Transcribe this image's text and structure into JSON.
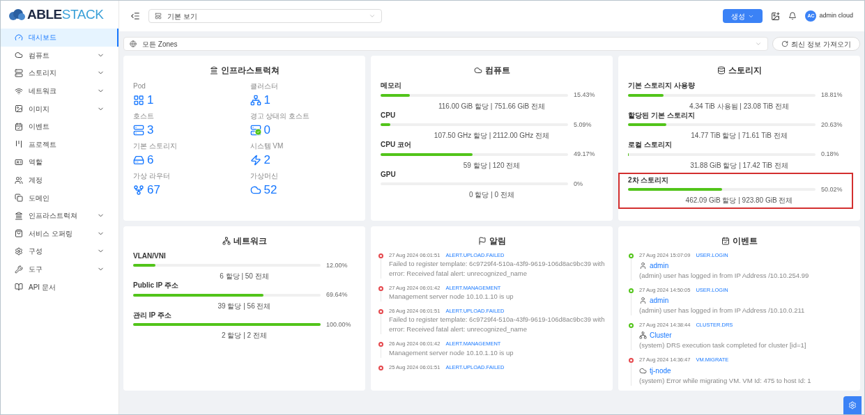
{
  "brand": {
    "part1": "ABLE",
    "part2": "STACK"
  },
  "sidebar": {
    "items": [
      {
        "label": "대시보드",
        "kind": "link",
        "selected": true
      },
      {
        "label": "컴퓨트",
        "kind": "group",
        "selected": false
      },
      {
        "label": "스토리지",
        "kind": "group",
        "selected": false
      },
      {
        "label": "네트워크",
        "kind": "group",
        "selected": false
      },
      {
        "label": "이미지",
        "kind": "group",
        "selected": false
      },
      {
        "label": "이벤트",
        "kind": "link",
        "selected": false
      },
      {
        "label": "프로젝트",
        "kind": "link",
        "selected": false
      },
      {
        "label": "역할",
        "kind": "link",
        "selected": false
      },
      {
        "label": "계정",
        "kind": "link",
        "selected": false
      },
      {
        "label": "도메인",
        "kind": "link",
        "selected": false
      },
      {
        "label": "인프라스트럭쳐",
        "kind": "group",
        "selected": false
      },
      {
        "label": "서비스 오퍼링",
        "kind": "group",
        "selected": false
      },
      {
        "label": "구성",
        "kind": "group",
        "selected": false
      },
      {
        "label": "도구",
        "kind": "group",
        "selected": false
      },
      {
        "label": "API 문서",
        "kind": "link",
        "selected": false
      }
    ]
  },
  "header": {
    "view_select": "기본 보기",
    "create_button": "생성",
    "user": {
      "initials": "AC",
      "name": "admin cloud"
    }
  },
  "zone_select": "모든 Zones",
  "refresh_button": "최신 정보 가져오기",
  "infrastructure": {
    "title": "인프라스트럭쳐",
    "stats": [
      {
        "label": "Pod",
        "value": "1"
      },
      {
        "label": "클러스터",
        "value": "1"
      },
      {
        "label": "호스트",
        "value": "3"
      },
      {
        "label": "경고 상태의 호스트",
        "value": "0"
      },
      {
        "label": "기본 스토리지",
        "value": "6"
      },
      {
        "label": "시스템 VM",
        "value": "2"
      },
      {
        "label": "가상 라우터",
        "value": "67"
      },
      {
        "label": "가상머신",
        "value": "52"
      }
    ]
  },
  "compute": {
    "title": "컴퓨트",
    "rows": [
      {
        "label": "메모리",
        "level": 0.1543,
        "percent": "15.43%",
        "detail": "116.00 GiB 할당 | 751.66 GiB 전체"
      },
      {
        "label": "CPU",
        "level": 0.0509,
        "percent": "5.09%",
        "detail": "107.50 GHz 할당 | 2112.00 GHz 전체"
      },
      {
        "label": "CPU 코어",
        "level": 0.4917,
        "percent": "49.17%",
        "detail": "59 할당 | 120 전체"
      },
      {
        "label": "GPU",
        "level": 0,
        "percent": "0%",
        "detail": "0 할당 | 0 전체"
      }
    ]
  },
  "storage": {
    "title": "스토리지",
    "rows": [
      {
        "label": "기본 스토리지 사용량",
        "level": 0.1881,
        "percent": "18.81%",
        "detail": "4.34 TiB 사용됨 | 23.08 TiB 전체",
        "highlighted": false
      },
      {
        "label": "할당된 기본 스토리지",
        "level": 0.2063,
        "percent": "20.63%",
        "detail": "14.77 TiB 할당 | 71.61 TiB 전체",
        "highlighted": false
      },
      {
        "label": "로컬 스토리지",
        "level": 0.0018,
        "percent": "0.18%",
        "detail": "31.88 GiB 할당 | 17.42 TiB 전체",
        "highlighted": false
      },
      {
        "label": "2차 스토리지",
        "level": 0.5002,
        "percent": "50.02%",
        "detail": "462.09 GiB 할당 | 923.80 GiB 전체",
        "highlighted": true
      }
    ]
  },
  "network": {
    "title": "네트워크",
    "rows": [
      {
        "label": "VLAN/VNI",
        "level": 0.12,
        "percent": "12.00%",
        "detail": "6 할당 | 50 전체"
      },
      {
        "label": "Public IP 주소",
        "level": 0.6964,
        "percent": "69.64%",
        "detail": "39 할당 | 56 전체"
      },
      {
        "label": "관리 IP 주소",
        "level": 1,
        "percent": "100.00%",
        "detail": "2 할당 | 2 전체"
      }
    ]
  },
  "alerts": {
    "title": "알림",
    "items": [
      {
        "time": "27 Aug 2024 06:01:51",
        "type": "ALERT.UPLOAD.FAILED",
        "message": "Failed to register template: 6c9729f4-510a-43f9-9619-106d8ac9bc39 with error: Received fatal alert: unrecognized_name",
        "color": "#e5484d"
      },
      {
        "time": "27 Aug 2024 06:01:42",
        "type": "ALERT.MANAGEMENT",
        "message": "Management server node 10.10.1.10 is up",
        "color": "#e5484d"
      },
      {
        "time": "26 Aug 2024 06:01:51",
        "type": "ALERT.UPLOAD.FAILED",
        "message": "Failed to register template: 6c9729f4-510a-43f9-9619-106d8ac9bc39 with error: Received fatal alert: unrecognized_name",
        "color": "#e5484d"
      },
      {
        "time": "26 Aug 2024 06:01:42",
        "type": "ALERT.MANAGEMENT",
        "message": "Management server node 10.10.1.10 is up",
        "color": "#e5484d"
      },
      {
        "time": "25 Aug 2024 06:01:51",
        "type": "ALERT.UPLOAD.FAILED",
        "color": "#e5484d"
      }
    ]
  },
  "events": {
    "title": "이벤트",
    "items": [
      {
        "time": "27 Aug 2024 15:07:09",
        "type": "USER.LOGIN",
        "kind": "user",
        "resource": "admin",
        "message": "(admin) user has logged in from IP Address /10.10.254.99",
        "color": "#52c41a"
      },
      {
        "time": "27 Aug 2024 14:50:05",
        "type": "USER.LOGIN",
        "kind": "user",
        "resource": "admin",
        "message": "(admin) user has logged in from IP Address /10.10.0.211",
        "color": "#52c41a"
      },
      {
        "time": "27 Aug 2024 14:38:44",
        "type": "CLUSTER.DRS",
        "kind": "cluster",
        "resource": "Cluster",
        "message": "(system) DRS execution task completed for cluster [id=1]",
        "color": "#52c41a"
      },
      {
        "time": "27 Aug 2024 14:36:47",
        "type": "VM.MIGRATE",
        "kind": "vm",
        "resource": "tj-node",
        "message": "(system) Error while migrating VM. VM Id: 475 to host Id: 1",
        "color": "#e5484d"
      }
    ]
  }
}
